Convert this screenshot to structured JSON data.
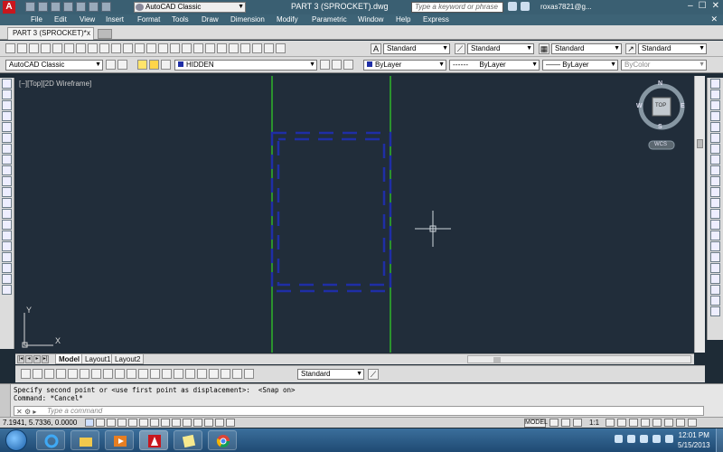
{
  "titlebar": {
    "app_logo": "A",
    "workspace": "AutoCAD Classic",
    "document_title": "PART 3 (SPROCKET).dwg",
    "search_placeholder": "Type a keyword or phrase",
    "user": "roxas7821@g...",
    "controls": [
      "–",
      "☐",
      "✕"
    ]
  },
  "menubar": {
    "items": [
      "File",
      "Edit",
      "View",
      "Insert",
      "Format",
      "Tools",
      "Draw",
      "Dimension",
      "Modify",
      "Parametric",
      "Window",
      "Help",
      "Express"
    ],
    "close": "✕"
  },
  "tabs": {
    "document_tab": "PART 3 (SPROCKET)*",
    "close": "x"
  },
  "toolbar1": {
    "text_style": "Standard",
    "dim_style": "Standard",
    "table_style": "Standard",
    "multileader_style": "Standard"
  },
  "toolbar2": {
    "workspace": "AutoCAD Classic",
    "layer": "HIDDEN",
    "color": "ByLayer",
    "linetype": "ByLayer",
    "lineweight": "ByLayer",
    "plotstyle": "ByColor"
  },
  "viewport": {
    "label": "[−][Top][2D Wireframe]",
    "viewcube": {
      "top_face": "TOP",
      "north": "N",
      "south": "S",
      "east": "E",
      "west": "W",
      "wcs": "WCS"
    },
    "ucs": {
      "x": "X",
      "y": "Y"
    }
  },
  "layout_tabs": [
    "Model",
    "Layout1",
    "Layout2"
  ],
  "dimension_bar": {
    "dim_style": "Standard"
  },
  "command": {
    "line1": "Specify second point or <use first point as displacement>:  <Snap on>",
    "line2": "Command: *Cancel*",
    "prompt": "Type  a  command"
  },
  "status": {
    "coords": "7.1941, 5.7336, 0.0000",
    "model": "MODEL",
    "scale": "1:1"
  },
  "taskbar": {
    "time": "12:01 PM",
    "date": "5/15/2013"
  },
  "colors": {
    "canvas": "#212d3a",
    "centerline": "#2fb52a",
    "hidden_lines": "#1f2ea6",
    "titlebar": "#3a5f72"
  }
}
